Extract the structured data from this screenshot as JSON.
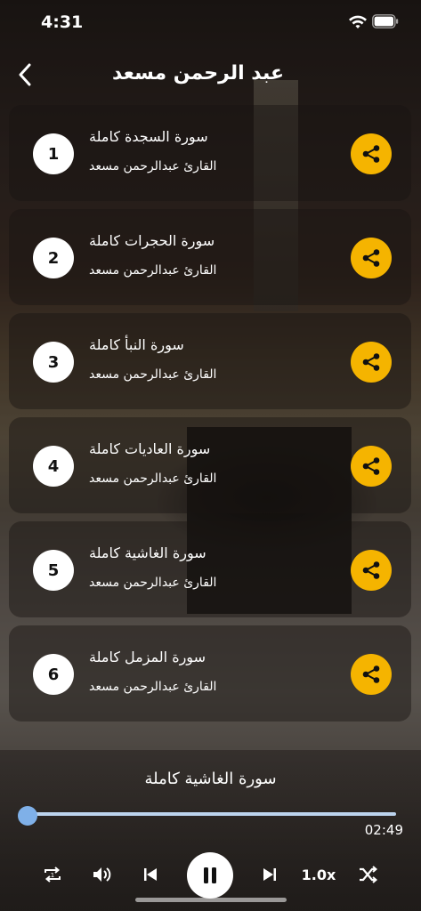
{
  "status_bar": {
    "time": "4:31",
    "wifi_icon": "wifi-icon",
    "battery_icon": "battery-icon"
  },
  "header": {
    "title": "عبد الرحمن مسعد",
    "back_icon": "chevron-left-icon"
  },
  "tracks": [
    {
      "number": "1",
      "title": "سورة السجدة كاملة",
      "reciter": "القارئ عبدالرحمن مسعد"
    },
    {
      "number": "2",
      "title": "سورة الحجرات كاملة",
      "reciter": "القارئ عبدالرحمن مسعد"
    },
    {
      "number": "3",
      "title": "سورة النبأ كاملة",
      "reciter": "القارئ عبدالرحمن مسعد"
    },
    {
      "number": "4",
      "title": "سورة العاديات كاملة",
      "reciter": "القارئ عبدالرحمن مسعد"
    },
    {
      "number": "5",
      "title": "سورة الغاشية كاملة",
      "reciter": "القارئ عبدالرحمن مسعد"
    },
    {
      "number": "6",
      "title": "سورة المزمل كاملة",
      "reciter": "القارئ عبدالرحمن مسعد"
    }
  ],
  "player": {
    "now_playing": "سورة الغاشية كاملة",
    "duration": "02:49",
    "progress": 0.0,
    "speed": "1.0x",
    "controls": [
      "repeat-one-icon",
      "volume-icon",
      "previous-icon",
      "pause-icon",
      "next-icon",
      "speed",
      "shuffle-icon"
    ]
  },
  "colors": {
    "accent": "#f5b400",
    "progress": "#8fb8e6"
  }
}
